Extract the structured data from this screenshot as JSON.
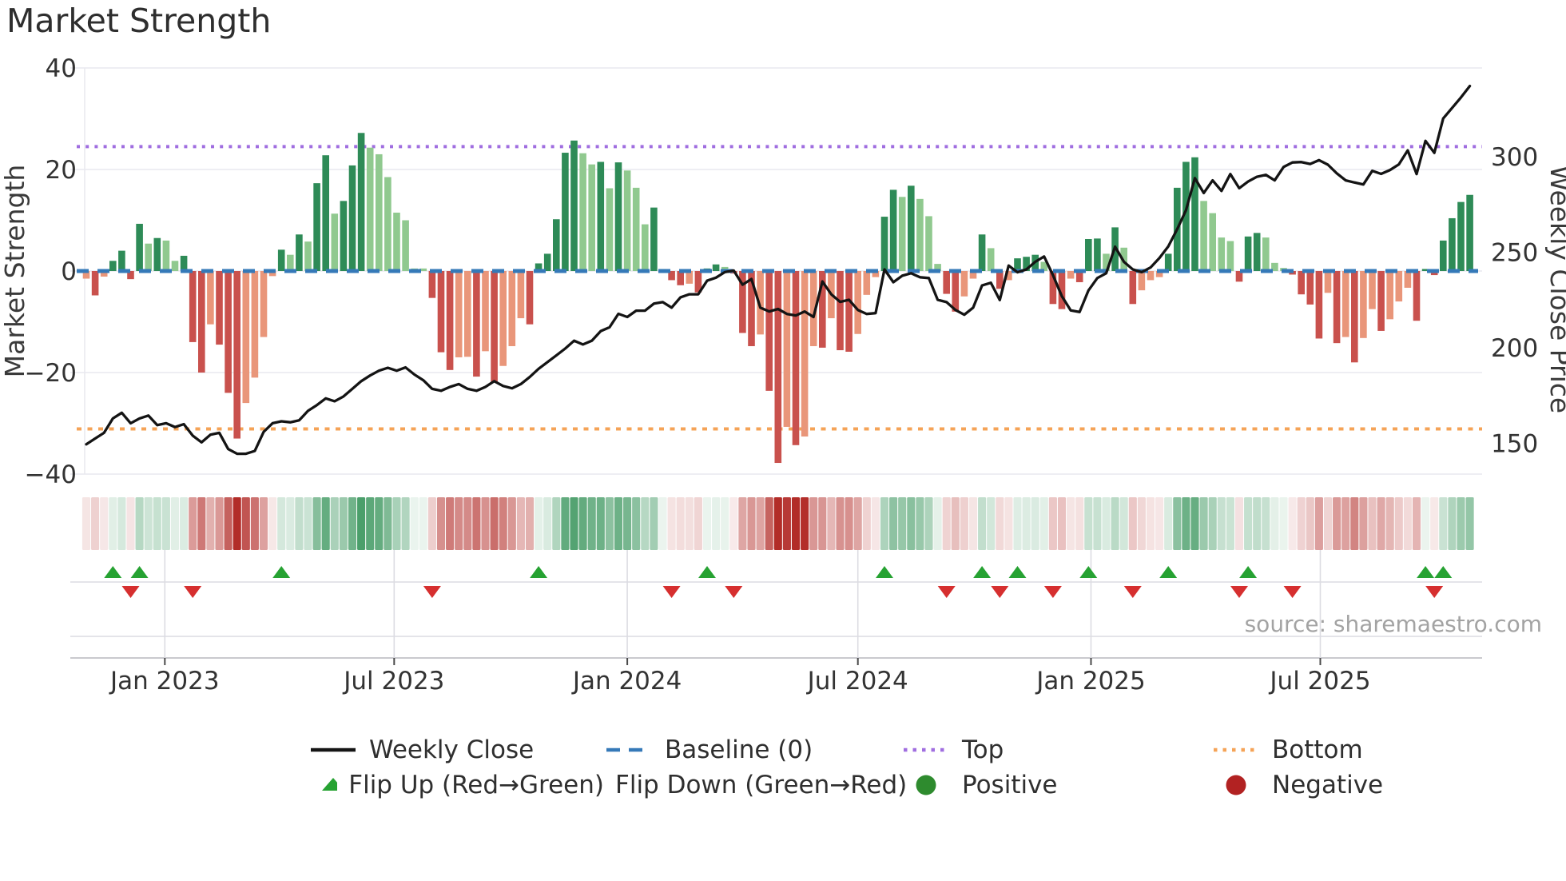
{
  "title": "Market Strength",
  "source": "source: sharemaestro.com",
  "axes": {
    "left": {
      "title": "Market Strength",
      "ticks": [
        40,
        20,
        0,
        -20,
        -40
      ],
      "range": [
        -40,
        40
      ]
    },
    "right": {
      "title": "Weekly Close Price",
      "ticks": [
        300,
        250,
        200,
        150
      ],
      "range": [
        145,
        350
      ]
    },
    "x": {
      "ticks": [
        {
          "label": "Jan 2023",
          "date": "2023-01-01"
        },
        {
          "label": "Jul 2023",
          "date": "2023-07-01"
        },
        {
          "label": "Jan 2024",
          "date": "2024-01-01"
        },
        {
          "label": "Jul 2024",
          "date": "2024-07-01"
        },
        {
          "label": "Jan 2025",
          "date": "2025-01-01"
        },
        {
          "label": "Jul 2025",
          "date": "2025-07-01"
        }
      ]
    }
  },
  "ref_lines": {
    "baseline": {
      "label": "Baseline (0)",
      "value": 0,
      "color": "#3579b8",
      "style": "dashed"
    },
    "top": {
      "label": "Top",
      "value": 24.5,
      "color": "#a06ee0",
      "style": "dotted"
    },
    "bottom": {
      "label": "Bottom",
      "value": -31.1,
      "color": "#f5a357",
      "style": "dotted"
    }
  },
  "legend": {
    "items": [
      {
        "label": "Weekly Close",
        "marker": "line",
        "color": "#141414"
      },
      {
        "label": "Baseline (0)",
        "marker": "dashed",
        "color": "#3579b8"
      },
      {
        "label": "Top",
        "marker": "dotted",
        "color": "#a06ee0"
      },
      {
        "label": "Bottom",
        "marker": "dotted",
        "color": "#f5a357"
      },
      {
        "label": "Flip Up (Red→Green)",
        "marker": "triangle-up",
        "color": "#26a232"
      },
      {
        "label": "Flip Down (Green→Red)",
        "marker": "triangle-down",
        "color": "#d62f2f"
      },
      {
        "label": "Positive",
        "marker": "circle",
        "color": "#2e8b2e"
      },
      {
        "label": "Negative",
        "marker": "circle",
        "color": "#b22222"
      }
    ]
  },
  "colors": {
    "bar_up_strong": "#2e8b57",
    "bar_up_soft": "#90c98f",
    "bar_down_strong": "#c9514d",
    "bar_down_soft": "#e9967a",
    "price_line": "#141414",
    "baseline": "#3579b8",
    "top_line": "#a06ee0",
    "bottom_line": "#f5a357",
    "flip_up": "#26a232",
    "flip_down": "#d62f2f",
    "heat_green": "#288c4e",
    "heat_red": "#b22c28",
    "grid": "#e9e9ef",
    "panel_grid": "#dcdce2",
    "axis_line": "#c9c9ce",
    "text": "#333333",
    "muted_text": "#a3a3a3"
  },
  "chart_data": {
    "type": "combo (weekly bar oscillator + line price + heatmap strip + flip markers)",
    "title": "Market Strength",
    "ylabel_left": "Market Strength",
    "ylabel_right": "Weekly Close Price",
    "x_start_date": "2022-10-31",
    "x_interval": "weekly",
    "n_weeks": 157,
    "ylim_left": [
      -40,
      40
    ],
    "top_level": 24.5,
    "bottom_level": -31.1,
    "series": [
      {
        "name": "Market Strength",
        "type": "bar",
        "axis": "left",
        "values": [
          -1.5,
          -4.8,
          -1.1,
          2,
          4,
          -1.6,
          9.3,
          5.4,
          6.5,
          6,
          2,
          3,
          -14,
          -20,
          -10.5,
          -14.5,
          -24,
          -33,
          -26,
          -21,
          -13,
          -1,
          4.2,
          3.2,
          7.2,
          5.8,
          17.3,
          22.8,
          11.3,
          13.8,
          20.8,
          27.2,
          24.3,
          23,
          18.5,
          11.5,
          10,
          0.5,
          0.5,
          -5.3,
          -16,
          -19.5,
          -17,
          -16.9,
          -20.8,
          -15.8,
          -21.8,
          -18.7,
          -14.8,
          -9.3,
          -10.5,
          1.5,
          3.4,
          10.2,
          23.3,
          25.7,
          23.2,
          21,
          21.5,
          16.3,
          21.4,
          19.8,
          16.4,
          9.2,
          12.5,
          0.4,
          -1.8,
          -2.8,
          -2.5,
          -4.2,
          0.5,
          1.3,
          0.8,
          -0.5,
          -12.2,
          -14.8,
          -12.5,
          -23.6,
          -37.8,
          -30.7,
          -34.3,
          -32.6,
          -14.8,
          -15.1,
          -9.3,
          -15.6,
          -15.9,
          -12.4,
          -4.7,
          -1.2,
          10.7,
          16,
          14.6,
          16.8,
          14.2,
          10.8,
          1.4,
          -4.5,
          -8,
          -5,
          -1.5,
          7.2,
          4.5,
          -3.5,
          -1.8,
          2.5,
          2.8,
          3.2,
          1.8,
          -6.5,
          -7.5,
          -1.5,
          -2.2,
          6.3,
          6.4,
          3.4,
          8.6,
          4.6,
          -6.5,
          -3.8,
          -1.8,
          -1.2,
          3.4,
          16.4,
          21.5,
          22.4,
          13.8,
          11.4,
          6.6,
          5.9,
          -2.1,
          6.8,
          7.5,
          6.6,
          1.6,
          0.6,
          -0.7,
          -4.6,
          -6.6,
          -13.3,
          -4.3,
          -14.2,
          -13,
          -18,
          -13.2,
          -7.5,
          -11.8,
          -9.5,
          -6,
          -3.3,
          -9.8,
          0.4,
          -0.8,
          6,
          10.4,
          13.6,
          15
        ]
      },
      {
        "name": "Weekly Close",
        "type": "line",
        "axis": "right",
        "values": [
          149.5,
          152.5,
          155.5,
          163,
          166,
          160.5,
          163,
          164.5,
          159.5,
          160.5,
          158.5,
          160,
          154,
          150.5,
          154.5,
          155.5,
          147,
          144.5,
          144.5,
          146,
          156,
          160.5,
          161.5,
          161,
          162,
          167,
          170,
          173.5,
          172,
          174.5,
          178.5,
          182.5,
          185.5,
          188,
          189.5,
          188,
          189.7,
          186,
          183,
          178.5,
          177.5,
          179.5,
          181,
          178.5,
          177.5,
          179.5,
          182.5,
          180,
          178.8,
          181,
          184.7,
          189,
          192.5,
          196,
          199.6,
          203.7,
          201.7,
          203.7,
          208.7,
          210.7,
          217.8,
          216.1,
          219.4,
          219.4,
          223.1,
          223.9,
          221,
          226.4,
          228,
          228,
          235.1,
          236.7,
          239.6,
          240.4,
          233,
          236,
          221,
          219,
          220.3,
          217.7,
          216.9,
          219,
          216.1,
          234.7,
          228,
          224,
          225.1,
          219.8,
          217.7,
          218.1,
          241,
          234.3,
          237.7,
          239,
          236.9,
          236.5,
          225.1,
          223.9,
          219.8,
          217.3,
          221,
          232.6,
          234,
          225,
          243,
          239.5,
          241,
          245,
          247.8,
          238,
          227,
          219.6,
          218.7,
          230,
          236.5,
          239,
          252.9,
          245,
          241,
          239.6,
          242,
          247,
          253,
          262,
          272,
          288.8,
          281,
          287.6,
          282.1,
          290.9,
          283.5,
          287,
          289.5,
          290.5,
          287.6,
          294.6,
          297,
          297.2,
          296.2,
          298.2,
          295.8,
          291.3,
          287.6,
          286.5,
          285.5,
          292.6,
          291,
          293,
          296,
          303.3,
          290.9,
          308.3,
          302,
          320,
          325.5,
          331,
          337
        ]
      }
    ],
    "flip_up_weeks": [
      3,
      6,
      22,
      51,
      70,
      90,
      101,
      105,
      113,
      122,
      131,
      151,
      153
    ],
    "flip_down_weeks": [
      5,
      12,
      39,
      66,
      73,
      97,
      103,
      109,
      118,
      130,
      136,
      152
    ],
    "bar_color_rule": "strong shade when magnitude grows vs previous week, soft shade when it fades",
    "heatmap": "same weekly Market Strength values; green = positive, red = negative, intensity = magnitude",
    "legend_position": "bottom, 4 columns x 2 rows",
    "grid": "horizontal gridlines at left-axis ticks"
  }
}
